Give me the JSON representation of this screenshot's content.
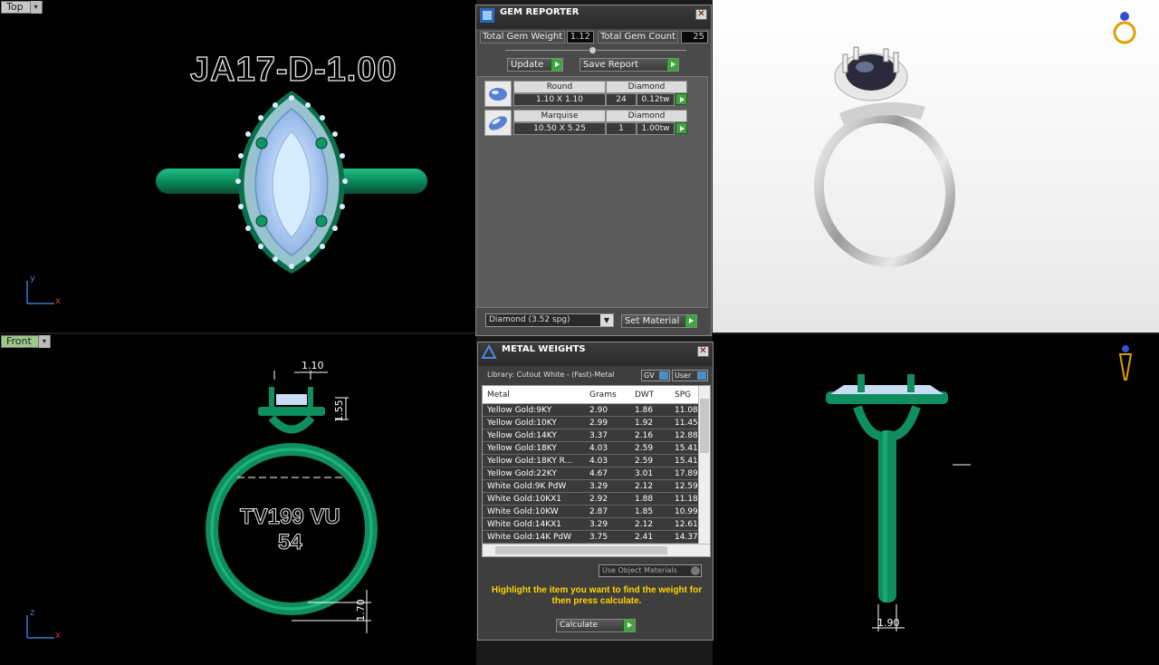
{
  "viewports": {
    "top_label": "Top",
    "front_label": "Front",
    "top_text": "JA17-D-1.00",
    "front_text_line1": "TV199 VU",
    "front_text_line2": "54",
    "dim_top": "1.10",
    "dim_height": "1.55",
    "dim_bottom": "1.70",
    "dim_side": "1.90",
    "axis_y": "y",
    "axis_x": "x",
    "axis_z": "z"
  },
  "gem_reporter": {
    "title": "GEM REPORTER",
    "total_weight_label": "Total Gem Weight",
    "total_weight": "1.12",
    "total_count_label": "Total Gem Count",
    "total_count": "25",
    "update_label": "Update",
    "save_label": "Save Report",
    "gems": [
      {
        "shape": "Round",
        "material": "Diamond",
        "size": "1.10 X 1.10",
        "count": "24",
        "weight": "0.12tw"
      },
      {
        "shape": "Marquise",
        "material": "Diamond",
        "size": "10.50 X 5.25",
        "count": "1",
        "weight": "1.00tw"
      }
    ],
    "material_select": "Diamond     (3.52 spg)",
    "set_material_label": "Set Material"
  },
  "metal_weights": {
    "title": "METAL WEIGHTS",
    "library": "Library: Cutout White - (Fast)-Metal",
    "gv_label": "GV",
    "user_label": "User",
    "columns": [
      "Metal",
      "Grams",
      "DWT",
      "SPG"
    ],
    "rows": [
      [
        "Yellow Gold:9KY",
        "2.90",
        "1.86",
        "11.08"
      ],
      [
        "Yellow Gold:10KY",
        "2.99",
        "1.92",
        "11.45"
      ],
      [
        "Yellow Gold:14KY",
        "3.37",
        "2.16",
        "12.88"
      ],
      [
        "Yellow Gold:18KY",
        "4.03",
        "2.59",
        "15.41"
      ],
      [
        "Yellow Gold:18KY R...",
        "4.03",
        "2.59",
        "15.41"
      ],
      [
        "Yellow Gold:22KY",
        "4.67",
        "3.01",
        "17.89"
      ],
      [
        "White Gold:9K PdW",
        "3.29",
        "2.12",
        "12.59"
      ],
      [
        "White Gold:10KX1",
        "2.92",
        "1.88",
        "11.18"
      ],
      [
        "White Gold:10KW",
        "2.87",
        "1.85",
        "10.99"
      ],
      [
        "White Gold:14KX1",
        "3.29",
        "2.12",
        "12.61"
      ],
      [
        "White Gold:14K PdW",
        "3.75",
        "2.41",
        "14.37"
      ]
    ],
    "use_object_label": "Use Object Materials",
    "help_text": "Highlight the item you want to find the weight for then press calculate.",
    "calculate_label": "Calculate"
  },
  "colors": {
    "ring_green": "#0f8f5f",
    "panel_bg": "#4a4a4a",
    "accent_yellow": "#ffd400"
  }
}
